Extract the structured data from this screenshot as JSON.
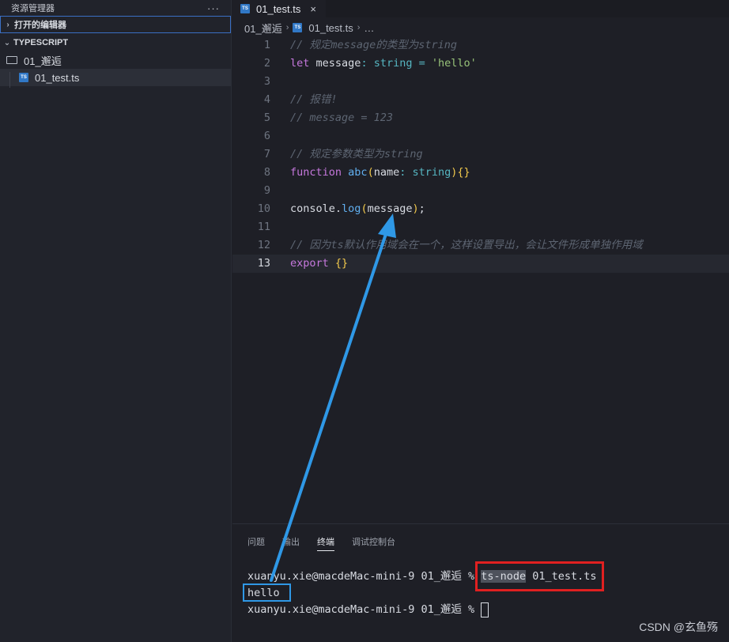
{
  "sidebar": {
    "title": "资源管理器",
    "more": "···",
    "open_editors": "打开的编辑器",
    "workspace": "TYPESCRIPT",
    "folder": "01_邂逅",
    "file": "01_test.ts"
  },
  "tab": {
    "label": "01_test.ts",
    "close": "×"
  },
  "breadcrumb": {
    "folder": "01_邂逅",
    "file": "01_test.ts",
    "more": "…"
  },
  "editor": {
    "lines": [
      {
        "n": "1",
        "t": "// 规定message的类型为string"
      },
      {
        "n": "2",
        "t": "let message: string = 'hello'"
      },
      {
        "n": "3",
        "t": ""
      },
      {
        "n": "4",
        "t": "// 报错!"
      },
      {
        "n": "5",
        "t": "// message = 123"
      },
      {
        "n": "6",
        "t": ""
      },
      {
        "n": "7",
        "t": "// 规定参数类型为string"
      },
      {
        "n": "8",
        "t": "function abc(name: string){}"
      },
      {
        "n": "9",
        "t": ""
      },
      {
        "n": "10",
        "t": "console.log(message);"
      },
      {
        "n": "11",
        "t": ""
      },
      {
        "n": "12",
        "t": "// 因为ts默认作用域会在一个，这样设置导出，会让文件形成单独作用域"
      },
      {
        "n": "13",
        "t": "export {}"
      }
    ]
  },
  "panel": {
    "tabs": [
      "问题",
      "输出",
      "终端",
      "调试控制台"
    ],
    "active_tab": "终端",
    "terminal": {
      "prompt1": "xuanyu.xie@macdeMac-mini-9 01_邂逅 % ",
      "cmd": "ts-node",
      "arg": " 01_test.ts",
      "output": "hello",
      "prompt2": "xuanyu.xie@macdeMac-mini-9 01_邂逅 % "
    }
  },
  "watermark": "CSDN @玄鱼殇",
  "colors": {
    "annotation_red": "#e02020",
    "annotation_blue": "#2f98e6"
  }
}
